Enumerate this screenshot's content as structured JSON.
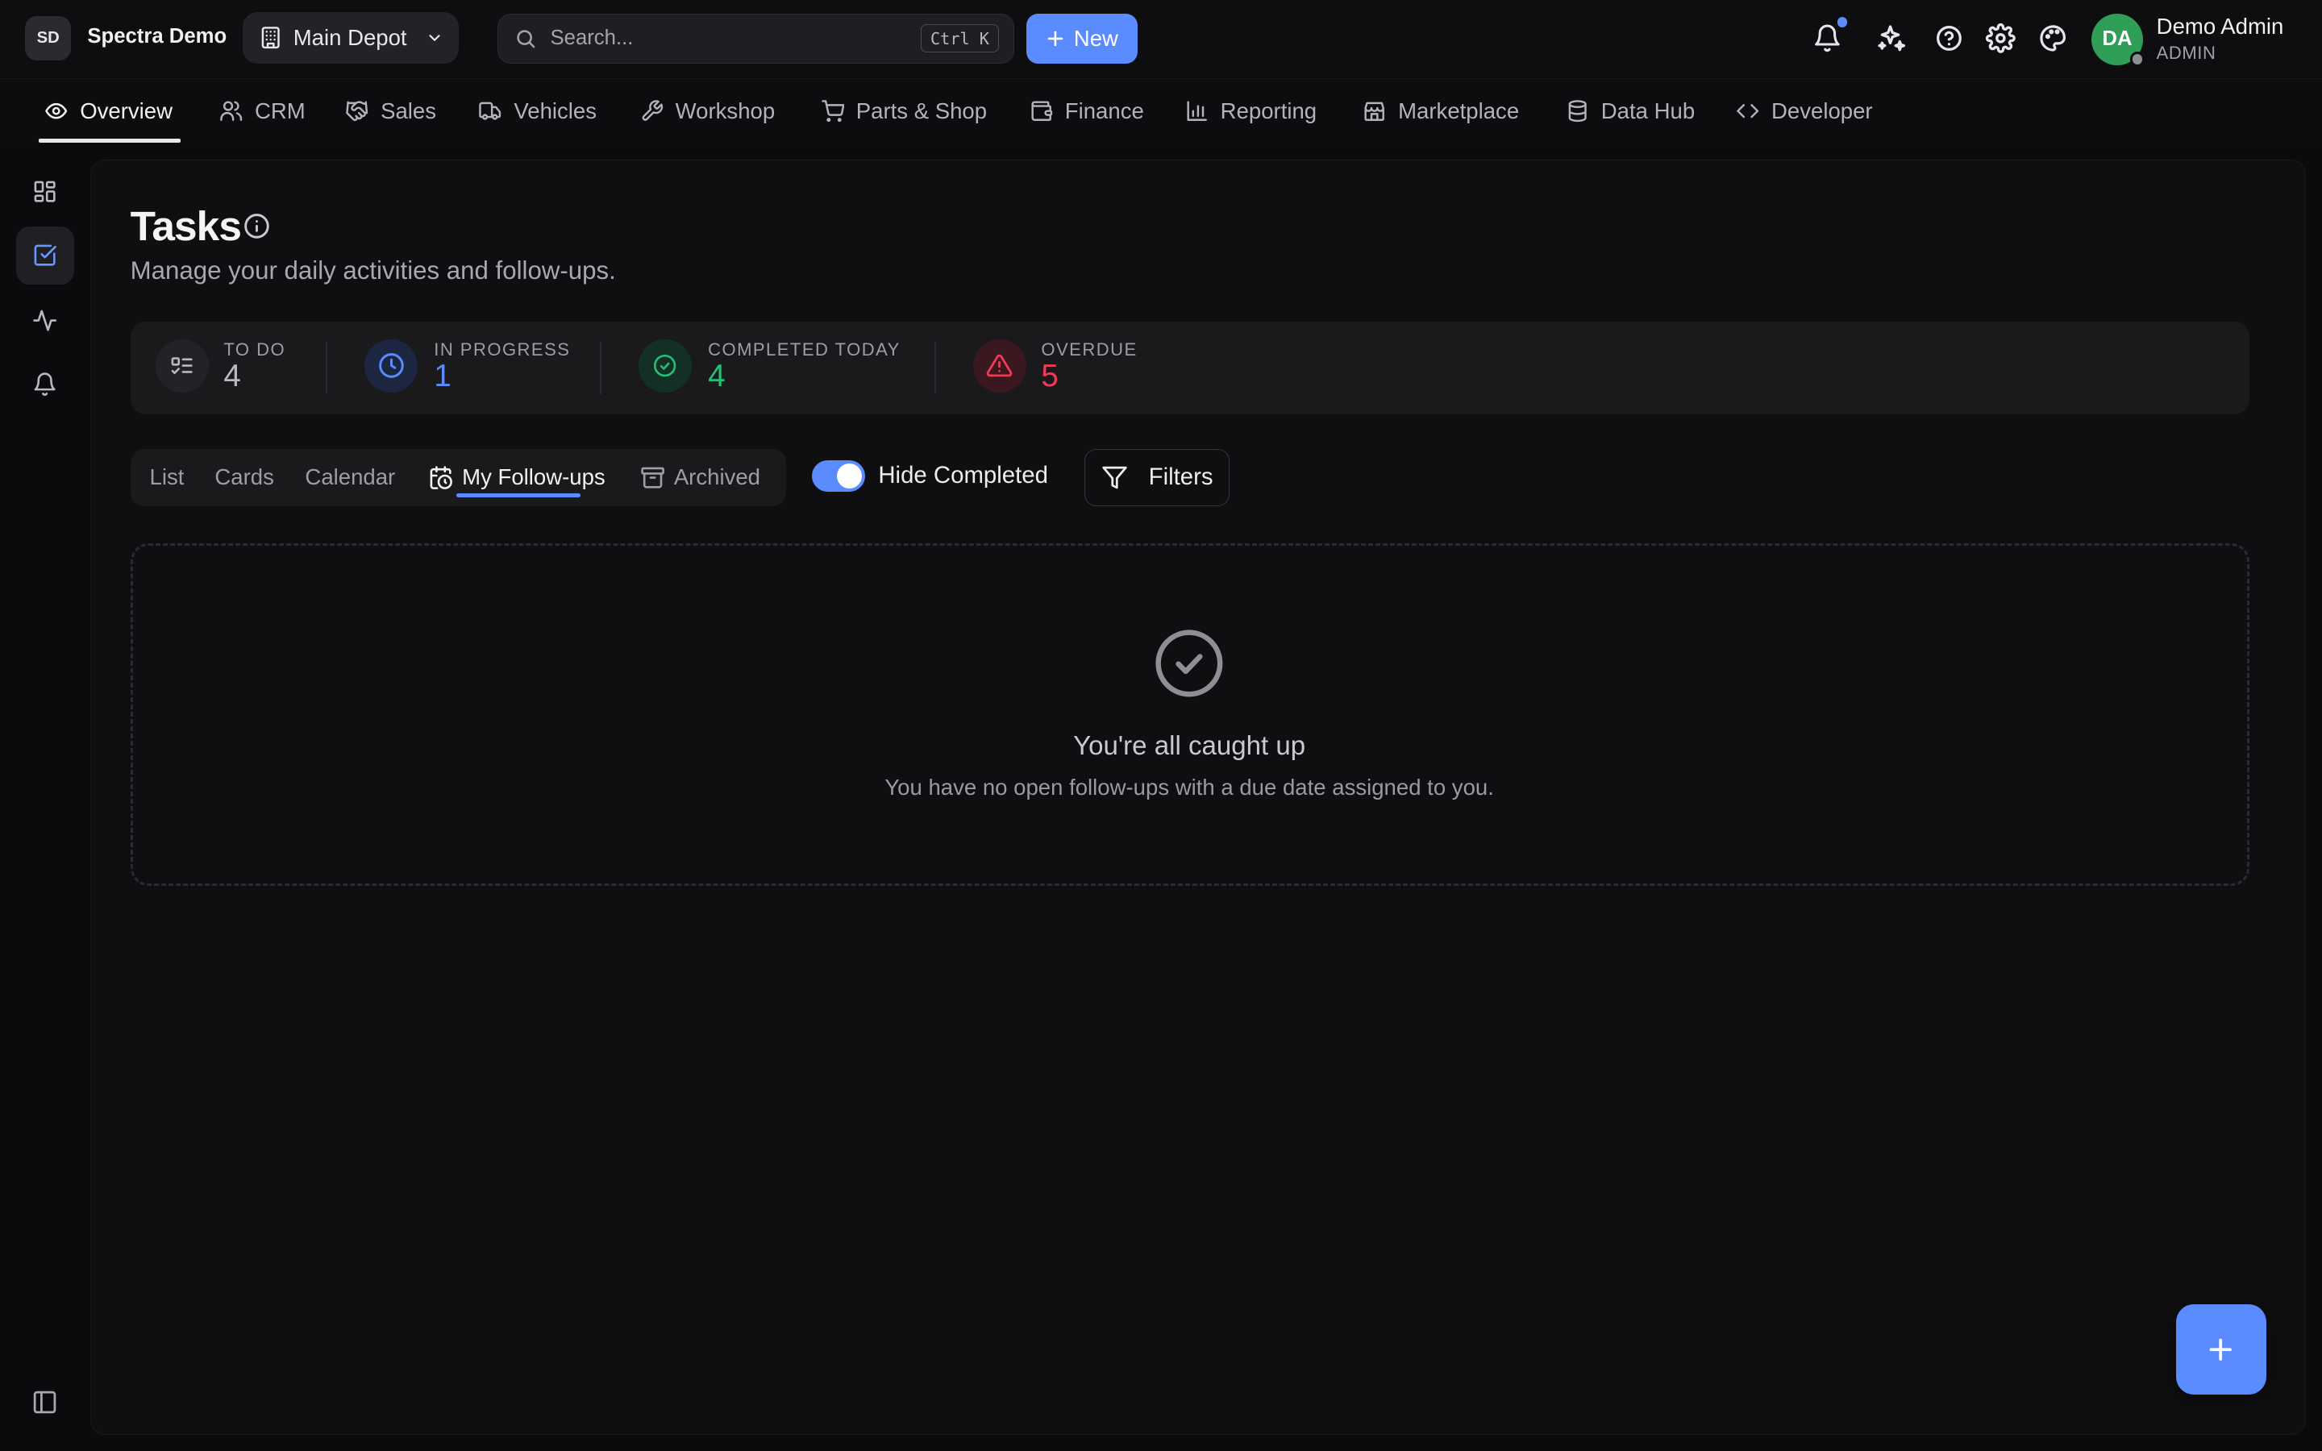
{
  "brand": {
    "initials": "SD",
    "name": "Spectra Demo"
  },
  "depot": {
    "label": "Main Depot"
  },
  "search": {
    "placeholder": "Search...",
    "shortcut": "Ctrl K"
  },
  "new_button": {
    "label": "New"
  },
  "user": {
    "initials": "DA",
    "name": "Demo Admin",
    "role": "ADMIN"
  },
  "nav": {
    "items": [
      {
        "label": "Overview",
        "icon": "eye-icon"
      },
      {
        "label": "CRM",
        "icon": "users-icon"
      },
      {
        "label": "Sales",
        "icon": "handshake-icon"
      },
      {
        "label": "Vehicles",
        "icon": "truck-icon"
      },
      {
        "label": "Workshop",
        "icon": "wrench-icon"
      },
      {
        "label": "Parts & Shop",
        "icon": "cart-icon"
      },
      {
        "label": "Finance",
        "icon": "wallet-icon"
      },
      {
        "label": "Reporting",
        "icon": "bar-chart-icon"
      },
      {
        "label": "Marketplace",
        "icon": "store-icon"
      },
      {
        "label": "Data Hub",
        "icon": "database-icon"
      },
      {
        "label": "Developer",
        "icon": "code-icon"
      }
    ]
  },
  "page": {
    "title": "Tasks",
    "subtitle": "Manage your daily activities and follow-ups."
  },
  "stats": [
    {
      "label": "To Do",
      "value": "4",
      "color": "#b9b9be"
    },
    {
      "label": "In Progress",
      "value": "1",
      "color": "#5b8cff"
    },
    {
      "label": "Completed Today",
      "value": "4",
      "color": "#22c07a"
    },
    {
      "label": "Overdue",
      "value": "5",
      "color": "#ef3b55"
    }
  ],
  "views": {
    "items": [
      {
        "label": "List"
      },
      {
        "label": "Cards"
      },
      {
        "label": "Calendar"
      },
      {
        "label": "My Follow-ups",
        "active": true
      },
      {
        "label": "Archived"
      }
    ]
  },
  "hide_completed": {
    "label": "Hide Completed",
    "on": true
  },
  "filters": {
    "label": "Filters"
  },
  "empty_state": {
    "title": "You're all caught up",
    "subtitle": "You have no open follow-ups with a due date assigned to you."
  },
  "colors": {
    "accent": "#5b8cff",
    "success": "#22c07a",
    "danger": "#ef3b55",
    "avatar": "#2f9e57"
  }
}
